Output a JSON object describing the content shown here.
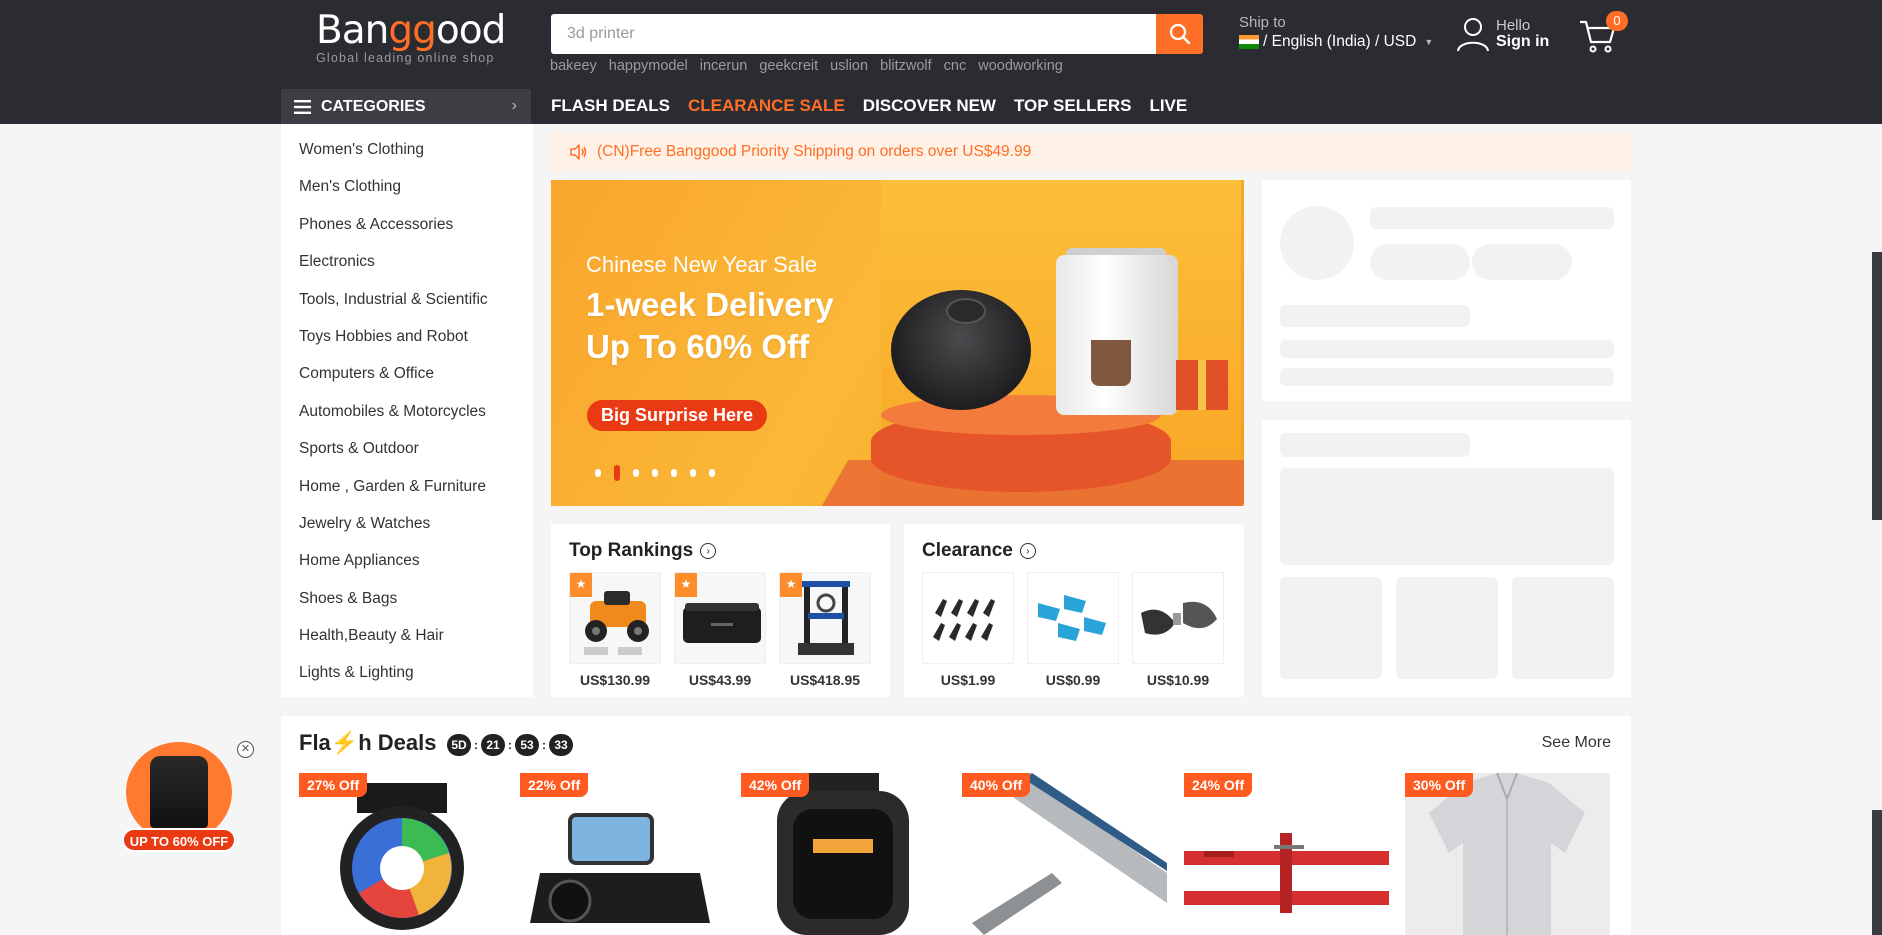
{
  "header": {
    "logo_text_pre": "Ban",
    "logo_text_g": "gg",
    "logo_text_post": "ood",
    "logo_tagline": "Global leading online shop",
    "search_value": "3d printer",
    "hot_words": [
      "bakeey",
      "happymodel",
      "incerun",
      "geekcreit",
      "uslion",
      "blitzwolf",
      "cnc",
      "woodworking"
    ],
    "ship_label": "Ship to",
    "ship_value": "/ English (India) / USD",
    "hello": "Hello",
    "signin": "Sign in",
    "cart_count": "0",
    "categories_label": "CATEGORIES",
    "nav": [
      {
        "label": "FLASH DEALS"
      },
      {
        "label": "CLEARANCE SALE"
      },
      {
        "label": "DISCOVER NEW"
      },
      {
        "label": "TOP SELLERS"
      },
      {
        "label": "LIVE"
      }
    ]
  },
  "categories": [
    "Women's Clothing",
    "Men's Clothing",
    "Phones & Accessories",
    "Electronics",
    "Tools, Industrial & Scientific",
    "Toys Hobbies and Robot",
    "Computers & Office",
    "Automobiles & Motorcycles",
    "Sports & Outdoor",
    "Home , Garden & Furniture",
    "Jewelry & Watches",
    "Home Appliances",
    "Shoes & Bags",
    "Health,Beauty & Hair",
    "Lights & Lighting"
  ],
  "notice": "(CN)Free Banggood Priority Shipping on orders over US$49.99",
  "banner": {
    "subtitle": "Chinese New Year Sale",
    "title_line1": "1-week Delivery",
    "title_line2": "Up To 60% Off",
    "button": "Big Surprise Here",
    "slide_count": 7,
    "active_slide": 2
  },
  "top_rankings": {
    "title": "Top Rankings",
    "items": [
      {
        "price": "US$130.99"
      },
      {
        "price": "US$43.99"
      },
      {
        "price": "US$418.95"
      }
    ]
  },
  "clearance": {
    "title": "Clearance",
    "items": [
      {
        "price": "US$1.99"
      },
      {
        "price": "US$0.99"
      },
      {
        "price": "US$10.99"
      }
    ]
  },
  "flash_deals": {
    "title_pre": "Fla",
    "title_bolt": "⚡",
    "title_post": "h Deals",
    "timer": {
      "days": "5D",
      "hours": "21",
      "minutes": "53",
      "seconds": "33"
    },
    "see_more": "See More",
    "items": [
      {
        "off": "27% Off"
      },
      {
        "off": "22% Off"
      },
      {
        "off": "42% Off"
      },
      {
        "off": "40% Off"
      },
      {
        "off": "24% Off"
      },
      {
        "off": "30% Off"
      }
    ]
  },
  "float_ad": {
    "label": "UP TO 60% OFF"
  },
  "colors": {
    "brand": "#ff6e26",
    "header_bg": "#2b2c32",
    "sale_red": "#e93a14"
  }
}
